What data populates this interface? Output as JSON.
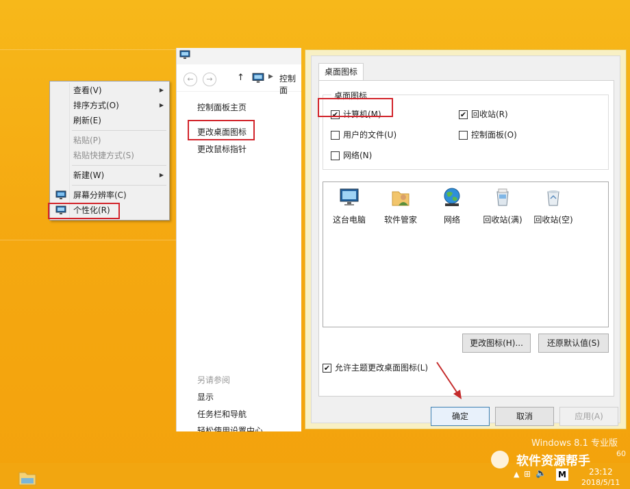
{
  "context_menu": {
    "items": [
      {
        "label": "查看(V)",
        "submenu": true
      },
      {
        "label": "排序方式(O)",
        "submenu": true
      },
      {
        "label": "刷新(E)"
      },
      {
        "label": "粘贴(P)",
        "disabled": true
      },
      {
        "label": "粘贴快捷方式(S)",
        "disabled": true
      },
      {
        "label": "新建(W)",
        "submenu": true
      },
      {
        "label": "屏幕分辨率(C)"
      },
      {
        "label": "个性化(R)"
      }
    ]
  },
  "personalization": {
    "address": "控制面",
    "links": {
      "home": "控制面板主页",
      "change_icons": "更改桌面图标",
      "change_pointer": "更改鼠标指针",
      "see_also": "另请参阅",
      "display": "显示",
      "taskbar": "任务栏和导航",
      "ease": "轻松使用设置中心"
    }
  },
  "dialog": {
    "tab": "桌面图标",
    "group_title": "桌面图标",
    "checkboxes": [
      {
        "label": "计算机(M)",
        "checked": true
      },
      {
        "label": "回收站(R)",
        "checked": true
      },
      {
        "label": "用户的文件(U)",
        "checked": false
      },
      {
        "label": "控制面板(O)",
        "checked": false
      },
      {
        "label": "网络(N)",
        "checked": false
      }
    ],
    "icons": [
      {
        "label": "这台电脑",
        "icon": "this-pc-icon"
      },
      {
        "label": "软件管家",
        "icon": "user-folder-icon"
      },
      {
        "label": "网络",
        "icon": "network-icon"
      },
      {
        "label": "回收站(满)",
        "icon": "recycle-bin-full-icon"
      },
      {
        "label": "回收站(空)",
        "icon": "recycle-bin-empty-icon"
      }
    ],
    "change_icon_button": "更改图标(H)...",
    "restore_default_button": "还原默认值(S)",
    "allow_themes": {
      "label": "允许主题更改桌面图标(L)",
      "checked": true
    },
    "ok_button": "确定",
    "cancel_button": "取消",
    "apply_button": "应用(A)"
  },
  "desktop": {
    "os_watermark": "Windows 8.1 专业版",
    "os_watermark_tail": "60",
    "brand": "软件资源帮手",
    "clock_time": "23:12",
    "clock_date": "2018/5/11",
    "tray_ime": "M"
  },
  "colors": {
    "desktop_bg": "#f5a911",
    "highlight_red": "#d2232a",
    "arrow": "#c42a2a"
  }
}
